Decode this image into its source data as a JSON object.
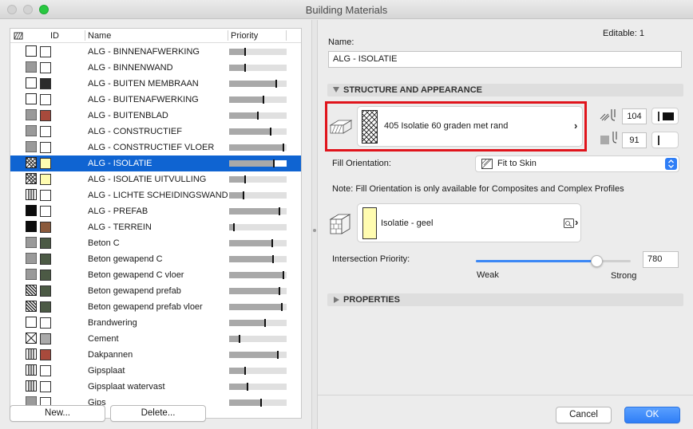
{
  "window": {
    "title": "Building Materials"
  },
  "list": {
    "headers": {
      "id": "ID",
      "name": "Name",
      "priority": "Priority"
    },
    "rows": [
      {
        "name": "ALG - BINNENAFWERKING",
        "fill": "empty",
        "color": "#ffffff",
        "priority": 0.28,
        "selected": false
      },
      {
        "name": "ALG - BINNENWAND",
        "fill": "gray",
        "color": "#ffffff",
        "priority": 0.28,
        "selected": false
      },
      {
        "name": "ALG - BUITEN MEMBRAAN",
        "fill": "empty",
        "color": "#2b2b2b",
        "priority": 0.82,
        "selected": false
      },
      {
        "name": "ALG - BUITENAFWERKING",
        "fill": "empty",
        "color": "#ffffff",
        "priority": 0.6,
        "selected": false
      },
      {
        "name": "ALG - BUITENBLAD",
        "fill": "gray",
        "color": "#a84a3c",
        "priority": 0.5,
        "selected": false
      },
      {
        "name": "ALG - CONSTRUCTIEF",
        "fill": "gray",
        "color": "#ffffff",
        "priority": 0.72,
        "selected": false
      },
      {
        "name": "ALG - CONSTRUCTIEF VLOER",
        "fill": "gray",
        "color": "#ffffff",
        "priority": 0.95,
        "selected": false
      },
      {
        "name": "ALG - ISOLATIE",
        "fill": "insul",
        "color": "#fffcb0",
        "priority": 0.78,
        "selected": true
      },
      {
        "name": "ALG - ISOLATIE UITVULLING",
        "fill": "insul",
        "color": "#fffcb0",
        "priority": 0.28,
        "selected": false
      },
      {
        "name": "ALG - LICHTE SCHEIDINGSWAND",
        "fill": "bars",
        "color": "#ffffff",
        "priority": 0.25,
        "selected": false
      },
      {
        "name": "ALG - PREFAB",
        "fill": "black",
        "color": "#ffffff",
        "priority": 0.88,
        "selected": false
      },
      {
        "name": "ALG - TERREIN",
        "fill": "black",
        "color": "#8b5a3c",
        "priority": 0.08,
        "selected": false
      },
      {
        "name": "Beton C",
        "fill": "gray",
        "color": "#4c5a45",
        "priority": 0.75,
        "selected": false
      },
      {
        "name": "Beton gewapend C",
        "fill": "gray",
        "color": "#4c5a45",
        "priority": 0.77,
        "selected": false
      },
      {
        "name": "Beton gewapend C vloer",
        "fill": "gray",
        "color": "#4c5a45",
        "priority": 0.95,
        "selected": false
      },
      {
        "name": "Beton gewapend prefab",
        "fill": "hatch",
        "color": "#4c5a45",
        "priority": 0.88,
        "selected": false
      },
      {
        "name": "Beton gewapend prefab vloer",
        "fill": "hatch",
        "color": "#4c5a45",
        "priority": 0.92,
        "selected": false
      },
      {
        "name": "Brandwering",
        "fill": "empty",
        "color": "#ffffff",
        "priority": 0.62,
        "selected": false
      },
      {
        "name": "Cement",
        "fill": "cross",
        "color": "#aaaaaa",
        "priority": 0.18,
        "selected": false
      },
      {
        "name": "Dakpannen",
        "fill": "bars",
        "color": "#a84a3c",
        "priority": 0.85,
        "selected": false
      },
      {
        "name": "Gipsplaat",
        "fill": "bars",
        "color": "#ffffff",
        "priority": 0.28,
        "selected": false
      },
      {
        "name": "Gipsplaat watervast",
        "fill": "bars",
        "color": "#ffffff",
        "priority": 0.32,
        "selected": false
      },
      {
        "name": "Gips",
        "fill": "gray",
        "color": "#ffffff",
        "priority": 0.55,
        "selected": false
      }
    ]
  },
  "buttons": {
    "new": "New...",
    "delete": "Delete...",
    "cancel": "Cancel",
    "ok": "OK"
  },
  "detail": {
    "editable": "Editable: 1",
    "name_label": "Name:",
    "name_value": "ALG - ISOLATIE",
    "structure_section": "STRUCTURE AND APPEARANCE",
    "fill_name": "405 Isolatie 60 graden met rand",
    "pen_top": "104",
    "pen_bottom": "91",
    "fill_orientation_label": "Fill Orientation:",
    "fill_orientation_value": "Fit to Skin",
    "note": "Note: Fill Orientation is only available for Composites and Complex Profiles",
    "surface_name": "Isolatie - geel",
    "surface_color": "#fffcb0",
    "intersection_label": "Intersection Priority:",
    "intersection_value": "780",
    "intersection_fraction": 0.78,
    "weak_label": "Weak",
    "strong_label": "Strong",
    "properties_section": "PROPERTIES"
  },
  "colors": {
    "selection": "#0f64d2",
    "ok_button": "#2f7ef6",
    "highlight_border": "#e0141c"
  }
}
